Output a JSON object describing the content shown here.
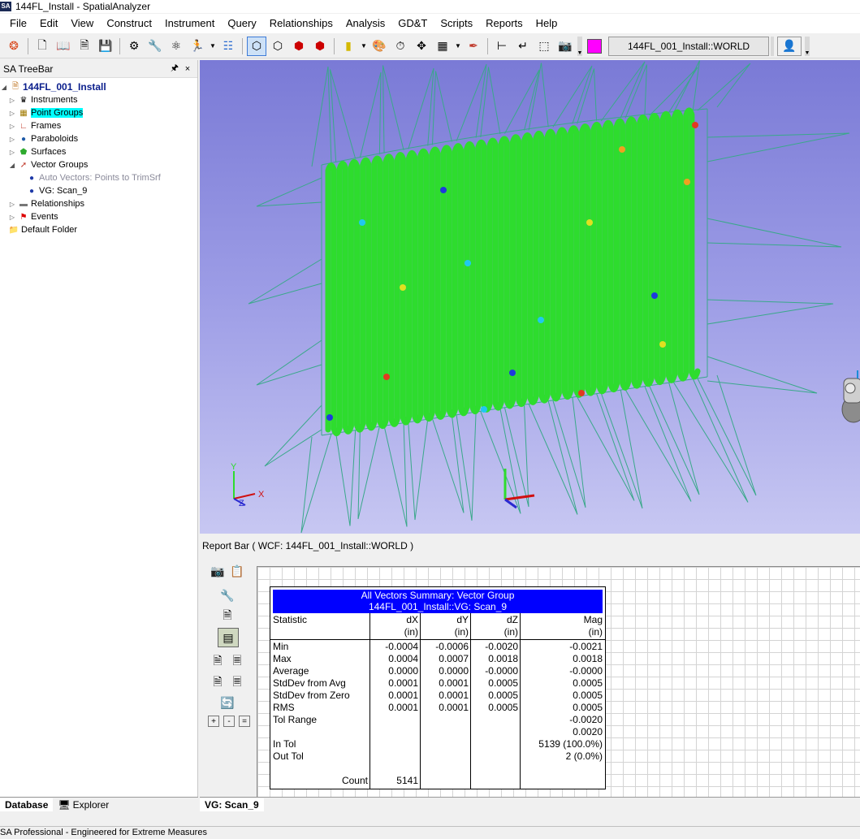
{
  "window": {
    "app_logo": "SA",
    "title": "144FL_Install - SpatialAnalyzer"
  },
  "menubar": [
    "File",
    "Edit",
    "View",
    "Construct",
    "Instrument",
    "Query",
    "Relationships",
    "Analysis",
    "GD&T",
    "Scripts",
    "Reports",
    "Help"
  ],
  "toolbar": {
    "active_frame": "144FL_001_Install::WORLD",
    "color": "#ff00ff"
  },
  "treebar": {
    "title": "SA TreeBar",
    "pin": " ท",
    "close": "×",
    "root": "144FL_001_Install",
    "items": {
      "instruments": "Instruments",
      "point_groups": "Point Groups",
      "frames": "Frames",
      "paraboloids": "Paraboloids",
      "surfaces": "Surfaces",
      "vector_groups": "Vector Groups",
      "vg_auto": "Auto Vectors: Points to  TrimSrf",
      "vg_scan": "VG: Scan_9",
      "relationships": "Relationships",
      "events": "Events",
      "default_folder": "Default Folder"
    },
    "tabs": {
      "database": "Database",
      "explorer": "Explorer"
    }
  },
  "viewport": {
    "axis_x_label": "X",
    "axis_y_label": "Y",
    "axis_z_label": "Z"
  },
  "reportbar": {
    "title": "Report Bar ( WCF: 144FL_001_Install::WORLD )",
    "tab": "VG: Scan_9",
    "table": {
      "title_line1": "All Vectors Summary: Vector Group",
      "title_line2": "144FL_001_Install::VG: Scan_9",
      "headers": {
        "statistic": "Statistic",
        "dx": "dX",
        "dy": "dY",
        "dz": "dZ",
        "mag": "Mag",
        "unit": "(in)"
      },
      "rows": [
        {
          "label": "Min",
          "dx": "-0.0004",
          "dy": "-0.0006",
          "dz": "-0.0020",
          "mag": "-0.0021"
        },
        {
          "label": "Max",
          "dx": "0.0004",
          "dy": "0.0007",
          "dz": "0.0018",
          "mag": "0.0018"
        },
        {
          "label": "Average",
          "dx": "0.0000",
          "dy": "0.0000",
          "dz": "-0.0000",
          "mag": "-0.0000"
        },
        {
          "label": "StdDev from Avg",
          "dx": "0.0001",
          "dy": "0.0001",
          "dz": "0.0005",
          "mag": "0.0005"
        },
        {
          "label": "StdDev from Zero",
          "dx": "0.0001",
          "dy": "0.0001",
          "dz": "0.0005",
          "mag": "0.0005"
        },
        {
          "label": "RMS",
          "dx": "0.0001",
          "dy": "0.0001",
          "dz": "0.0005",
          "mag": "0.0005"
        }
      ],
      "tol_range_label": "Tol Range",
      "tol_range_low": "-0.0020",
      "tol_range_high": "0.0020",
      "in_tol_label": "In Tol",
      "in_tol_value": "5139 (100.0%)",
      "out_tol_label": "Out Tol",
      "out_tol_value": "2 (0.0%)",
      "count_label": "Count",
      "count_value": "5141"
    }
  },
  "statusbar": {
    "text": "SA Professional - Engineered for Extreme Measures"
  }
}
